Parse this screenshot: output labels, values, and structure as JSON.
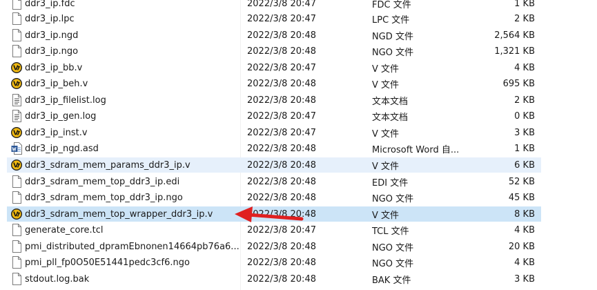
{
  "files": [
    {
      "name": "ddr3_ip.fdc",
      "date": "2022/3/8 20:47",
      "type": "FDC 文件",
      "size": "1 KB",
      "icon": "file-icon"
    },
    {
      "name": "ddr3_ip.lpc",
      "date": "2022/3/8 20:47",
      "type": "LPC 文件",
      "size": "2 KB",
      "icon": "file-icon"
    },
    {
      "name": "ddr3_ip.ngd",
      "date": "2022/3/8 20:48",
      "type": "NGD 文件",
      "size": "2,564 KB",
      "icon": "file-icon"
    },
    {
      "name": "ddr3_ip.ngo",
      "date": "2022/3/8 20:48",
      "type": "NGO 文件",
      "size": "1,321 KB",
      "icon": "file-icon"
    },
    {
      "name": "ddr3_ip_bb.v",
      "date": "2022/3/8 20:47",
      "type": "V 文件",
      "size": "4 KB",
      "icon": "verilog-icon"
    },
    {
      "name": "ddr3_ip_beh.v",
      "date": "2022/3/8 20:48",
      "type": "V 文件",
      "size": "695 KB",
      "icon": "verilog-icon"
    },
    {
      "name": "ddr3_ip_filelist.log",
      "date": "2022/3/8 20:48",
      "type": "文本文档",
      "size": "2 KB",
      "icon": "text-file-icon"
    },
    {
      "name": "ddr3_ip_gen.log",
      "date": "2022/3/8 20:47",
      "type": "文本文档",
      "size": "0 KB",
      "icon": "text-file-icon"
    },
    {
      "name": "ddr3_ip_inst.v",
      "date": "2022/3/8 20:47",
      "type": "V 文件",
      "size": "3 KB",
      "icon": "verilog-icon"
    },
    {
      "name": "ddr3_ip_ngd.asd",
      "date": "2022/3/8 20:48",
      "type": "Microsoft Word 自...",
      "size": "1 KB",
      "icon": "word-file-icon"
    },
    {
      "name": "ddr3_sdram_mem_params_ddr3_ip.v",
      "date": "2022/3/8 20:48",
      "type": "V 文件",
      "size": "6 KB",
      "icon": "verilog-icon"
    },
    {
      "name": "ddr3_sdram_mem_top_ddr3_ip.edi",
      "date": "2022/3/8 20:48",
      "type": "EDI 文件",
      "size": "52 KB",
      "icon": "file-icon"
    },
    {
      "name": "ddr3_sdram_mem_top_ddr3_ip.ngo",
      "date": "2022/3/8 20:48",
      "type": "NGO 文件",
      "size": "45 KB",
      "icon": "file-icon"
    },
    {
      "name": "ddr3_sdram_mem_top_wrapper_ddr3_ip.v",
      "date": "2022/3/8 20:48",
      "type": "V 文件",
      "size": "8 KB",
      "icon": "verilog-icon"
    },
    {
      "name": "generate_core.tcl",
      "date": "2022/3/8 20:47",
      "type": "TCL 文件",
      "size": "4 KB",
      "icon": "file-icon"
    },
    {
      "name": "pmi_distributed_dpramEbnonen14664pb76a6...",
      "date": "2022/3/8 20:48",
      "type": "NGO 文件",
      "size": "20 KB",
      "icon": "file-icon"
    },
    {
      "name": "pmi_pll_fp0O50E51441pedc3cf6.ngo",
      "date": "2022/3/8 20:48",
      "type": "NGO 文件",
      "size": "4 KB",
      "icon": "file-icon"
    },
    {
      "name": "stdout.log.bak",
      "date": "2022/3/8 20:48",
      "type": "BAK 文件",
      "size": "3 KB",
      "icon": "file-icon"
    }
  ],
  "colors": {
    "hover_row": "#e6f0fb",
    "selected_row": "#cce4f7",
    "arrow": "#e02020"
  }
}
